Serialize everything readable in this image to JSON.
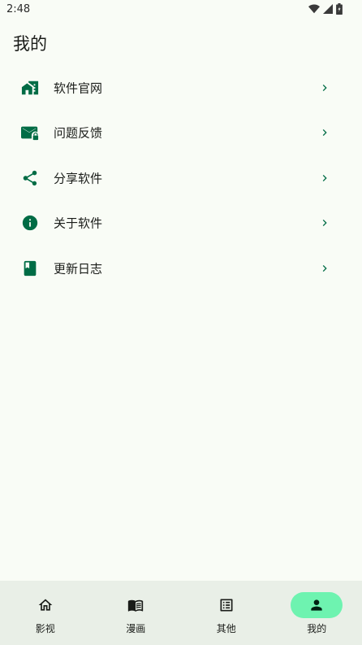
{
  "status_bar": {
    "time": "2:48"
  },
  "page": {
    "title": "我的"
  },
  "accent_color": "#006c45",
  "menu": {
    "items": [
      {
        "label": "软件官网",
        "icon": "home-work-icon"
      },
      {
        "label": "问题反馈",
        "icon": "mail-lock-icon"
      },
      {
        "label": "分享软件",
        "icon": "share-icon"
      },
      {
        "label": "关于软件",
        "icon": "info-icon"
      },
      {
        "label": "更新日志",
        "icon": "book-icon"
      }
    ]
  },
  "bottom_nav": {
    "selected_pill_color": "#6ef3b0",
    "items": [
      {
        "label": "影视",
        "icon": "home-icon",
        "selected": false
      },
      {
        "label": "漫画",
        "icon": "open-book-icon",
        "selected": false
      },
      {
        "label": "其他",
        "icon": "list-alt-icon",
        "selected": false
      },
      {
        "label": "我的",
        "icon": "person-icon",
        "selected": true
      }
    ]
  }
}
